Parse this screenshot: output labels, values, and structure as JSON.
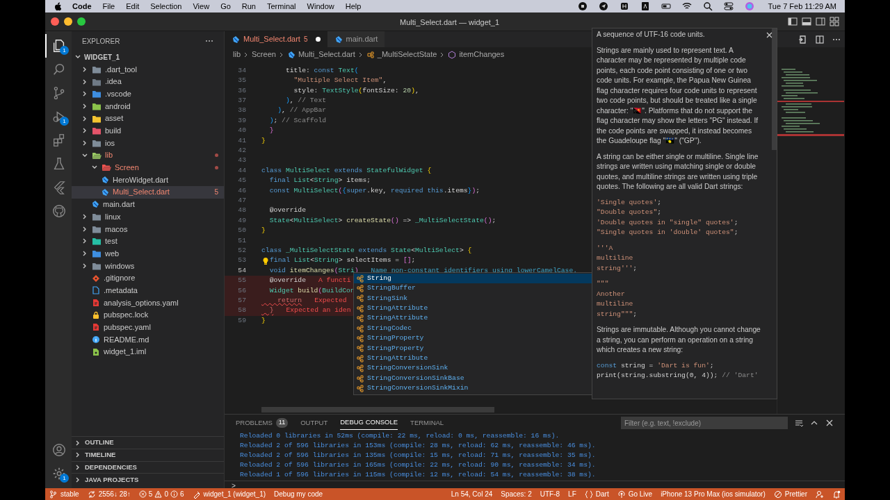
{
  "menubar": {
    "app": "Code",
    "items": [
      "File",
      "Edit",
      "Selection",
      "View",
      "Go",
      "Run",
      "Terminal",
      "Window",
      "Help"
    ],
    "clock": "Tue 7 Feb  11:29 AM"
  },
  "window": {
    "title": "Multi_Select.dart — widget_1"
  },
  "activity_bar": {
    "items": [
      {
        "kind": "files",
        "selected": true,
        "badge": "1"
      },
      {
        "kind": "search",
        "selected": false
      },
      {
        "kind": "source-control",
        "selected": false
      },
      {
        "kind": "debug",
        "selected": false,
        "badge": "1"
      },
      {
        "kind": "extensions",
        "selected": false
      },
      {
        "kind": "testing",
        "selected": false
      },
      {
        "kind": "flutter",
        "selected": false
      },
      {
        "kind": "github",
        "selected": false
      }
    ],
    "bottom": [
      {
        "kind": "account"
      },
      {
        "kind": "settings",
        "badge": "1"
      }
    ]
  },
  "sidebar": {
    "title": "EXPLORER",
    "root": "WIDGET_1",
    "items": [
      {
        "name": ".dart_tool",
        "kind": "folder",
        "color": "#7f8c99",
        "expanded": false
      },
      {
        "name": ".idea",
        "kind": "folder",
        "color": "#6f7a86",
        "expanded": false
      },
      {
        "name": ".vscode",
        "kind": "folder",
        "color": "#3e8ee0",
        "expanded": false
      },
      {
        "name": "android",
        "kind": "folder",
        "color": "#8bc34a",
        "expanded": false
      },
      {
        "name": "asset",
        "kind": "folder",
        "color": "#f4c430",
        "expanded": false
      },
      {
        "name": "build",
        "kind": "folder",
        "color": "#e5546a",
        "expanded": false
      },
      {
        "name": "ios",
        "kind": "folder",
        "color": "#7f8c99",
        "expanded": false
      },
      {
        "name": "lib",
        "kind": "folder",
        "color": "#9ccc65",
        "expanded": true,
        "errors": true,
        "children": [
          {
            "name": "Screen",
            "kind": "folder",
            "color": "#ef5350",
            "expanded": true,
            "errors": true,
            "children": [
              {
                "name": "HeroWidget.dart",
                "kind": "dart",
                "errors": false,
                "selected": false
              },
              {
                "name": "Multi_Select.dart",
                "kind": "dart",
                "errors": true,
                "selected": true,
                "badge": "5"
              }
            ]
          },
          {
            "name": "main.dart",
            "kind": "dart",
            "errors": false,
            "selected": false
          }
        ]
      },
      {
        "name": "linux",
        "kind": "folder",
        "color": "#7f8c99",
        "expanded": false
      },
      {
        "name": "macos",
        "kind": "folder",
        "color": "#7f8c99",
        "expanded": false
      },
      {
        "name": "test",
        "kind": "folder",
        "color": "#26bfa5",
        "expanded": false
      },
      {
        "name": "web",
        "kind": "folder",
        "color": "#3e8ee0",
        "expanded": false
      },
      {
        "name": "windows",
        "kind": "folder",
        "color": "#7f8c99",
        "expanded": false
      },
      {
        "name": ".gitignore",
        "kind": "git"
      },
      {
        "name": ".metadata",
        "kind": "file"
      },
      {
        "name": "analysis_options.yaml",
        "kind": "yaml"
      },
      {
        "name": "pubspec.lock",
        "kind": "lock"
      },
      {
        "name": "pubspec.yaml",
        "kind": "yaml"
      },
      {
        "name": "README.md",
        "kind": "info"
      },
      {
        "name": "widget_1.iml",
        "kind": "iml"
      }
    ],
    "sections": [
      "OUTLINE",
      "TIMELINE",
      "DEPENDENCIES",
      "JAVA PROJECTS"
    ]
  },
  "tabs": [
    {
      "label": "Multi_Select.dart",
      "badge": "5",
      "dirty": true,
      "errors": true,
      "selected": true
    },
    {
      "label": "main.dart",
      "dirty": false,
      "errors": false,
      "selected": false
    }
  ],
  "breadcrumbs": [
    {
      "kind": "folder",
      "text": "lib"
    },
    {
      "kind": "folder",
      "text": "Screen"
    },
    {
      "kind": "dart",
      "text": "Multi_Select.dart"
    },
    {
      "kind": "class",
      "text": "_MultiSelectState"
    },
    {
      "kind": "method",
      "text": "itemChanges"
    }
  ],
  "code": [
    {
      "number": "34",
      "tokens": [
        {
          "text": "      title: ",
          "kind": "plain"
        },
        {
          "text": "const",
          "kind": "keyword"
        },
        {
          "text": " Text",
          "kind": "type"
        },
        {
          "text": "(",
          "kind": "bracket3"
        }
      ]
    },
    {
      "number": "35",
      "tokens": [
        {
          "text": "        \"Multiple Select Item\"",
          "kind": "string"
        },
        {
          "text": ",",
          "kind": "plain"
        }
      ]
    },
    {
      "number": "36",
      "tokens": [
        {
          "text": "        style: ",
          "kind": "plain"
        },
        {
          "text": "TextStyle",
          "kind": "type"
        },
        {
          "text": "(",
          "kind": "bracket1"
        },
        {
          "text": "fontSize: ",
          "kind": "plain"
        },
        {
          "text": "20",
          "kind": "number"
        },
        {
          "text": ")",
          "kind": "bracket1"
        },
        {
          "text": ",",
          "kind": "plain"
        }
      ]
    },
    {
      "number": "37",
      "tokens": [
        {
          "text": "      )",
          "kind": "bracket3"
        },
        {
          "text": ",",
          "kind": "plain"
        },
        {
          "text": " // Text",
          "kind": "comment"
        }
      ]
    },
    {
      "number": "38",
      "tokens": [
        {
          "text": "    )",
          "kind": "bracket3"
        },
        {
          "text": ",",
          "kind": "plain"
        },
        {
          "text": " // AppBar",
          "kind": "comment"
        }
      ]
    },
    {
      "number": "39",
      "tokens": [
        {
          "text": "  )",
          "kind": "bracket3"
        },
        {
          "text": ";",
          "kind": "plain"
        },
        {
          "text": " // Scaffold",
          "kind": "comment"
        }
      ]
    },
    {
      "number": "40",
      "tokens": [
        {
          "text": "  }",
          "kind": "bracket2"
        }
      ]
    },
    {
      "number": "41",
      "tokens": [
        {
          "text": "}",
          "kind": "bracket1"
        }
      ]
    },
    {
      "number": "42"
    },
    {
      "number": "43"
    },
    {
      "number": "44",
      "tokens": [
        {
          "text": "class",
          "kind": "keyword"
        },
        {
          "text": " MultiSelect",
          "kind": "type"
        },
        {
          "text": " extends",
          "kind": "keyword"
        },
        {
          "text": " StatefulWidget",
          "kind": "type"
        },
        {
          "text": " {",
          "kind": "bracket1"
        }
      ]
    },
    {
      "number": "45",
      "tokens": [
        {
          "text": "  final",
          "kind": "keyword"
        },
        {
          "text": " List",
          "kind": "type"
        },
        {
          "text": "<",
          "kind": "plain"
        },
        {
          "text": "String",
          "kind": "type"
        },
        {
          "text": "> items;",
          "kind": "plain"
        }
      ]
    },
    {
      "number": "46",
      "tokens": [
        {
          "text": "  const",
          "kind": "keyword"
        },
        {
          "text": " MultiSelect",
          "kind": "type"
        },
        {
          "text": "(",
          "kind": "bracket2"
        },
        {
          "text": "{",
          "kind": "bracket3"
        },
        {
          "text": "super",
          "kind": "keyword"
        },
        {
          "text": ".key, ",
          "kind": "plain"
        },
        {
          "text": "required",
          "kind": "keyword"
        },
        {
          "text": " this",
          "kind": "keyword"
        },
        {
          "text": ".items",
          "kind": "plain"
        },
        {
          "text": "}",
          "kind": "bracket3"
        },
        {
          "text": ")",
          "kind": "bracket2"
        },
        {
          "text": ";",
          "kind": "plain"
        }
      ]
    },
    {
      "number": "47"
    },
    {
      "number": "48",
      "tokens": [
        {
          "text": "  @override",
          "kind": "plain"
        }
      ]
    },
    {
      "number": "49",
      "tokens": [
        {
          "text": "  State",
          "kind": "type"
        },
        {
          "text": "<",
          "kind": "plain"
        },
        {
          "text": "MultiSelect",
          "kind": "type"
        },
        {
          "text": "> ",
          "kind": "plain"
        },
        {
          "text": "createState",
          "kind": "function"
        },
        {
          "text": "()",
          "kind": "bracket2"
        },
        {
          "text": " => ",
          "kind": "plain"
        },
        {
          "text": "_MultiSelectState",
          "kind": "type"
        },
        {
          "text": "()",
          "kind": "bracket2"
        },
        {
          "text": ";",
          "kind": "plain"
        }
      ]
    },
    {
      "number": "50",
      "tokens": [
        {
          "text": "}",
          "kind": "bracket1"
        }
      ]
    },
    {
      "number": "51"
    },
    {
      "number": "52",
      "tokens": [
        {
          "text": "class",
          "kind": "keyword"
        },
        {
          "text": " _MultiSelectState",
          "kind": "type"
        },
        {
          "text": " extends",
          "kind": "keyword"
        },
        {
          "text": " State",
          "kind": "type"
        },
        {
          "text": "<",
          "kind": "plain"
        },
        {
          "text": "MultiSelect",
          "kind": "type"
        },
        {
          "text": "> ",
          "kind": "plain"
        },
        {
          "text": "{",
          "kind": "bracket1"
        }
      ]
    },
    {
      "number": "53",
      "lightbulb": true,
      "tokens": [
        {
          "text": "final",
          "kind": "keyword"
        },
        {
          "text": " List",
          "kind": "type"
        },
        {
          "text": "<",
          "kind": "plain"
        },
        {
          "text": "String",
          "kind": "type"
        },
        {
          "text": "> selectItems = ",
          "kind": "plain"
        },
        {
          "text": "[]",
          "kind": "bracket2"
        },
        {
          "text": ";",
          "kind": "plain"
        }
      ]
    },
    {
      "number": "54",
      "current": true,
      "tokens": [
        {
          "text": "  void",
          "kind": "keyword"
        },
        {
          "text": " itemChanges",
          "kind": "function"
        },
        {
          "text": "(",
          "kind": "bracket2"
        },
        {
          "text": "Stri",
          "kind": "type"
        },
        {
          "text": ")",
          "kind": "bracket2"
        }
      ],
      "diagnostic": {
        "kind": "info",
        "text": "Name non-constant identifiers using lowerCamelCase."
      }
    },
    {
      "number": "55",
      "error": true,
      "tokens": [
        {
          "text": "  @override",
          "kind": "plain"
        }
      ],
      "diagnostic": {
        "kind": "error",
        "text": "A functi"
      }
    },
    {
      "number": "56",
      "error": true,
      "tokens": [
        {
          "text": "  Widget",
          "kind": "type"
        },
        {
          "text": " build",
          "kind": "function"
        },
        {
          "text": "(",
          "kind": "bracket2"
        },
        {
          "text": "BuildCon",
          "kind": "type"
        }
      ]
    },
    {
      "number": "57",
      "error": true,
      "tokens": [
        {
          "text": "    return",
          "kind": "error"
        }
      ],
      "diagnostic": {
        "kind": "error",
        "text": "Expected"
      }
    },
    {
      "number": "58",
      "error": true,
      "tokens": [
        {
          "text": "  }",
          "kind": "error"
        }
      ],
      "diagnostic": {
        "kind": "error",
        "text": "Expected an iden"
      }
    },
    {
      "number": "59",
      "tokens": [
        {
          "text": "}",
          "kind": "bracket1"
        }
      ]
    }
  ],
  "suggestions": [
    {
      "label": "String",
      "selected": true
    },
    {
      "label": "StringBuffer",
      "selected": false
    },
    {
      "label": "StringSink",
      "selected": false
    },
    {
      "label": "StringAttribute",
      "selected": false
    },
    {
      "label": "StringAttribute",
      "selected": false
    },
    {
      "label": "StringCodec",
      "selected": false
    },
    {
      "label": "StringProperty",
      "selected": false
    },
    {
      "label": "StringProperty",
      "selected": false
    },
    {
      "label": "StringAttribute",
      "selected": false
    },
    {
      "label": "StringConversionSink",
      "selected": false
    },
    {
      "label": "StringConversionSinkBase",
      "selected": false
    },
    {
      "label": "StringConversionSinkMixin",
      "selected": false
    }
  ],
  "hover": {
    "blocks": [
      {
        "kind": "para",
        "text": "A sequence of UTF-16 code units."
      },
      {
        "kind": "para",
        "text": "Strings are mainly used to represent text. A character may be represented by multiple code points, each code point consisting of one or two code units. For example, the Papua New Guinea flag character requires four code units to represent two code points, but should be treated like a single character: \"🇵🇬\". Platforms that do not support the flag character may show the letters \"PG\" instead. If the code points are swapped, it instead becomes the Guadeloupe flag \"🇬🇵\" (\"GP\")."
      },
      {
        "kind": "para",
        "text": "A string can be either single or multiline. Single line strings are written using matching single or double quotes, and multiline strings are written using triple quotes. The following are all valid Dart strings:"
      },
      {
        "kind": "code",
        "lines": [
          [
            {
              "text": "'Single quotes'",
              "kind": "string"
            },
            {
              "text": ";",
              "kind": "plain"
            }
          ],
          [
            {
              "text": "\"Double quotes\"",
              "kind": "string"
            },
            {
              "text": ";",
              "kind": "plain"
            }
          ],
          [
            {
              "text": "'Double quotes in \"single\" quotes'",
              "kind": "string"
            },
            {
              "text": ";",
              "kind": "plain"
            }
          ],
          [
            {
              "text": "\"Single quotes in 'double' quotes\"",
              "kind": "string"
            },
            {
              "text": ";",
              "kind": "plain"
            }
          ]
        ]
      },
      {
        "kind": "code",
        "lines": [
          [
            {
              "text": "'''A",
              "kind": "string"
            }
          ],
          [
            {
              "text": "multiline",
              "kind": "string"
            }
          ],
          [
            {
              "text": "string'''",
              "kind": "string"
            },
            {
              "text": ";",
              "kind": "plain"
            }
          ]
        ]
      },
      {
        "kind": "code",
        "lines": [
          [
            {
              "text": "\"\"\"",
              "kind": "string"
            }
          ],
          [
            {
              "text": "Another",
              "kind": "string"
            }
          ],
          [
            {
              "text": "multiline",
              "kind": "string"
            }
          ],
          [
            {
              "text": "string\"\"\"",
              "kind": "string"
            },
            {
              "text": ";",
              "kind": "plain"
            }
          ]
        ]
      },
      {
        "kind": "para",
        "text": "Strings are immutable. Although you cannot change a string, you can perform an operation on a string which creates a new string:"
      },
      {
        "kind": "code",
        "lines": [
          [
            {
              "text": "const",
              "kind": "keyword"
            },
            {
              "text": " string = ",
              "kind": "plain"
            },
            {
              "text": "'Dart is fun'",
              "kind": "string"
            },
            {
              "text": ";",
              "kind": "plain"
            }
          ],
          [
            {
              "text": "print(string.substring(0, 4)); ",
              "kind": "plain"
            },
            {
              "text": "// 'Dart'",
              "kind": "comment"
            }
          ]
        ]
      }
    ]
  },
  "panel": {
    "tabs": [
      {
        "label": "PROBLEMS",
        "badge": "11",
        "selected": false
      },
      {
        "label": "OUTPUT",
        "selected": false
      },
      {
        "label": "DEBUG CONSOLE",
        "selected": true
      },
      {
        "label": "TERMINAL",
        "selected": false
      }
    ],
    "filter": {
      "placeholder": "Filter (e.g. text, !exclude)"
    },
    "lines": [
      "Reloaded 0 libraries in 52ms (compile: 22 ms, reload: 0 ms, reassemble: 16 ms).",
      "Reloaded 2 of 596 libraries in 153ms (compile: 28 ms, reload: 62 ms, reassemble: 46 ms).",
      "Reloaded 2 of 596 libraries in 135ms (compile: 15 ms, reload: 71 ms, reassemble: 35 ms).",
      "Reloaded 2 of 596 libraries in 165ms (compile: 22 ms, reload: 90 ms, reassemble: 34 ms).",
      "Reloaded 1 of 596 libraries in 115ms (compile: 12 ms, reload: 54 ms, reassemble: 38 ms)."
    ],
    "prompt": ">"
  },
  "status_bar": {
    "left": [
      {
        "kind": "branch",
        "text": "stable"
      },
      {
        "kind": "sync",
        "text": "2556↓ 28↑"
      },
      {
        "kind": "problems",
        "errors": "5",
        "warnings": "0",
        "infos": "6"
      },
      {
        "kind": "device",
        "text": "widget_1 (widget_1)"
      },
      {
        "kind": "plain",
        "text": "Debug my code"
      }
    ],
    "right": [
      {
        "kind": "plain",
        "text": "Ln 54, Col 24"
      },
      {
        "kind": "plain",
        "text": "Spaces: 2"
      },
      {
        "kind": "plain",
        "text": "UTF-8"
      },
      {
        "kind": "plain",
        "text": "LF"
      },
      {
        "kind": "braces",
        "text": "Dart"
      },
      {
        "kind": "live",
        "text": "Go Live"
      },
      {
        "kind": "plain",
        "text": "iPhone 13 Pro Max (ios simulator)"
      },
      {
        "kind": "prettier",
        "text": "Prettier"
      },
      {
        "kind": "feedback"
      },
      {
        "kind": "bell"
      }
    ]
  }
}
